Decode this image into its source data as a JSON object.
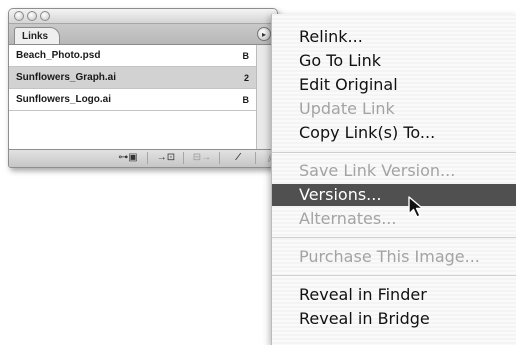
{
  "panel": {
    "tab_label": "Links",
    "menu_button_glyph": "▸",
    "rows": [
      {
        "name": "Beach_Photo.psd",
        "page": "B",
        "selected": false
      },
      {
        "name": "Sunflowers_Graph.ai",
        "page": "2",
        "selected": true
      },
      {
        "name": "Sunflowers_Logo.ai",
        "page": "B",
        "selected": false
      }
    ],
    "toolbar": {
      "relink_glyph": "⊶▣",
      "goto_glyph": "→⊡",
      "update_glyph": "⊟→",
      "edit_glyph": "⁄",
      "resize_glyph": "⫽"
    }
  },
  "menu": {
    "items": [
      {
        "label": "Relink...",
        "state": "enabled"
      },
      {
        "label": "Go To Link",
        "state": "enabled"
      },
      {
        "label": "Edit Original",
        "state": "enabled"
      },
      {
        "label": "Update Link",
        "state": "disabled"
      },
      {
        "label": "Copy Link(s) To...",
        "state": "enabled"
      },
      {
        "label": "Save Link Version...",
        "state": "disabled"
      },
      {
        "label": "Versions...",
        "state": "highlighted"
      },
      {
        "label": "Alternates...",
        "state": "disabled"
      },
      {
        "label": "Purchase This Image...",
        "state": "disabled"
      },
      {
        "label": "Reveal in Finder",
        "state": "enabled"
      },
      {
        "label": "Reveal in Bridge",
        "state": "enabled"
      }
    ]
  },
  "colors": {
    "highlight": "#505050",
    "disabled_text": "#a3a3a3",
    "selected_row": "#d2d2d2"
  },
  "icons": {
    "cursor": "arrow-pointer-icon",
    "panel_menu": "panel-menu-icon"
  }
}
